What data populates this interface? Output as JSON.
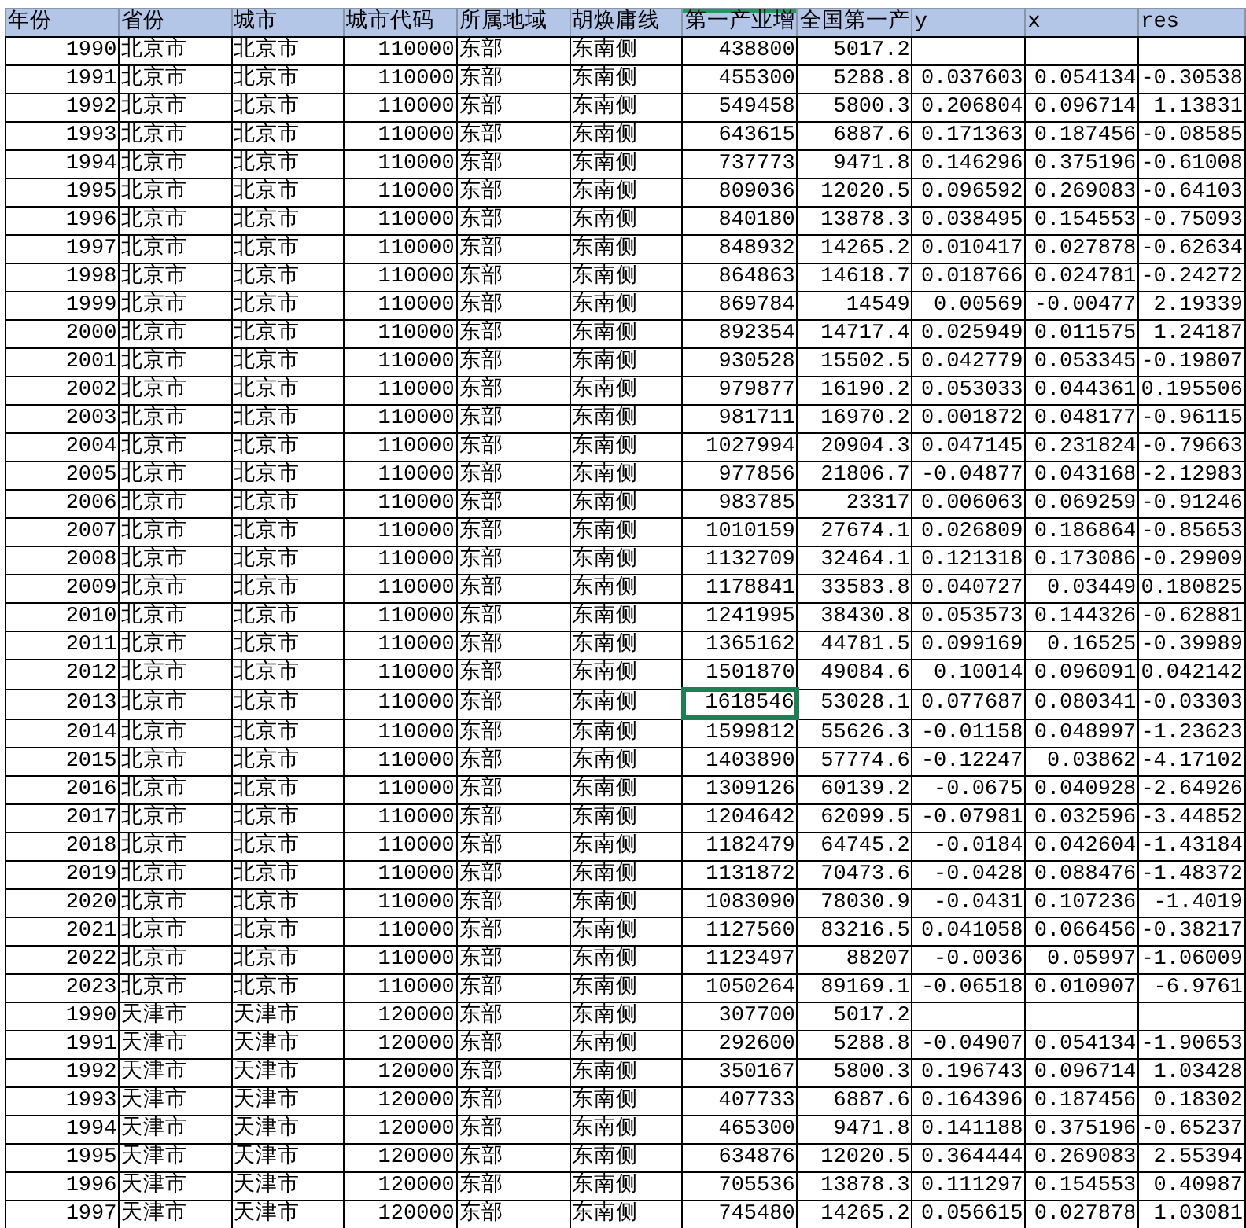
{
  "sheet": {
    "columns": [
      {
        "label": "年份",
        "kind": "number",
        "selected": false
      },
      {
        "label": "省份",
        "kind": "text",
        "selected": false
      },
      {
        "label": "城市",
        "kind": "text",
        "selected": false
      },
      {
        "label": "城市代码",
        "kind": "number",
        "selected": false
      },
      {
        "label": "所属地域",
        "kind": "text",
        "selected": false
      },
      {
        "label": "胡焕庸线",
        "kind": "text",
        "selected": false
      },
      {
        "label": "第一产业增",
        "kind": "number",
        "selected": true
      },
      {
        "label": "全国第一产",
        "kind": "number",
        "selected": false
      },
      {
        "label": "y",
        "kind": "number",
        "selected": false
      },
      {
        "label": "x",
        "kind": "number",
        "selected": false
      },
      {
        "label": "res",
        "kind": "number",
        "selected": false
      }
    ],
    "rows": [
      {
        "selected": false,
        "cells": [
          "1990",
          "北京市",
          "北京市",
          "110000",
          "东部",
          "东南侧",
          "438800",
          "5017.2",
          null,
          null,
          null
        ]
      },
      {
        "selected": false,
        "cells": [
          "1991",
          "北京市",
          "北京市",
          "110000",
          "东部",
          "东南侧",
          "455300",
          "5288.8",
          "0.037603",
          "0.054134",
          "-0.30538"
        ]
      },
      {
        "selected": false,
        "cells": [
          "1992",
          "北京市",
          "北京市",
          "110000",
          "东部",
          "东南侧",
          "549458",
          "5800.3",
          "0.206804",
          "0.096714",
          "1.13831"
        ]
      },
      {
        "selected": false,
        "cells": [
          "1993",
          "北京市",
          "北京市",
          "110000",
          "东部",
          "东南侧",
          "643615",
          "6887.6",
          "0.171363",
          "0.187456",
          "-0.08585"
        ]
      },
      {
        "selected": false,
        "cells": [
          "1994",
          "北京市",
          "北京市",
          "110000",
          "东部",
          "东南侧",
          "737773",
          "9471.8",
          "0.146296",
          "0.375196",
          "-0.61008"
        ]
      },
      {
        "selected": false,
        "cells": [
          "1995",
          "北京市",
          "北京市",
          "110000",
          "东部",
          "东南侧",
          "809036",
          "12020.5",
          "0.096592",
          "0.269083",
          "-0.64103"
        ]
      },
      {
        "selected": false,
        "cells": [
          "1996",
          "北京市",
          "北京市",
          "110000",
          "东部",
          "东南侧",
          "840180",
          "13878.3",
          "0.038495",
          "0.154553",
          "-0.75093"
        ]
      },
      {
        "selected": false,
        "cells": [
          "1997",
          "北京市",
          "北京市",
          "110000",
          "东部",
          "东南侧",
          "848932",
          "14265.2",
          "0.010417",
          "0.027878",
          "-0.62634"
        ]
      },
      {
        "selected": false,
        "cells": [
          "1998",
          "北京市",
          "北京市",
          "110000",
          "东部",
          "东南侧",
          "864863",
          "14618.7",
          "0.018766",
          "0.024781",
          "-0.24272"
        ]
      },
      {
        "selected": false,
        "cells": [
          "1999",
          "北京市",
          "北京市",
          "110000",
          "东部",
          "东南侧",
          "869784",
          "14549",
          "0.00569",
          "-0.00477",
          "2.19339"
        ]
      },
      {
        "selected": false,
        "cells": [
          "2000",
          "北京市",
          "北京市",
          "110000",
          "东部",
          "东南侧",
          "892354",
          "14717.4",
          "0.025949",
          "0.011575",
          "1.24187"
        ]
      },
      {
        "selected": false,
        "cells": [
          "2001",
          "北京市",
          "北京市",
          "110000",
          "东部",
          "东南侧",
          "930528",
          "15502.5",
          "0.042779",
          "0.053345",
          "-0.19807"
        ]
      },
      {
        "selected": false,
        "cells": [
          "2002",
          "北京市",
          "北京市",
          "110000",
          "东部",
          "东南侧",
          "979877",
          "16190.2",
          "0.053033",
          "0.044361",
          "0.195506"
        ]
      },
      {
        "selected": false,
        "cells": [
          "2003",
          "北京市",
          "北京市",
          "110000",
          "东部",
          "东南侧",
          "981711",
          "16970.2",
          "0.001872",
          "0.048177",
          "-0.96115"
        ]
      },
      {
        "selected": false,
        "cells": [
          "2004",
          "北京市",
          "北京市",
          "110000",
          "东部",
          "东南侧",
          "1027994",
          "20904.3",
          "0.047145",
          "0.231824",
          "-0.79663"
        ]
      },
      {
        "selected": false,
        "cells": [
          "2005",
          "北京市",
          "北京市",
          "110000",
          "东部",
          "东南侧",
          "977856",
          "21806.7",
          "-0.04877",
          "0.043168",
          "-2.12983"
        ]
      },
      {
        "selected": false,
        "cells": [
          "2006",
          "北京市",
          "北京市",
          "110000",
          "东部",
          "东南侧",
          "983785",
          "23317",
          "0.006063",
          "0.069259",
          "-0.91246"
        ]
      },
      {
        "selected": false,
        "cells": [
          "2007",
          "北京市",
          "北京市",
          "110000",
          "东部",
          "东南侧",
          "1010159",
          "27674.1",
          "0.026809",
          "0.186864",
          "-0.85653"
        ]
      },
      {
        "selected": false,
        "cells": [
          "2008",
          "北京市",
          "北京市",
          "110000",
          "东部",
          "东南侧",
          "1132709",
          "32464.1",
          "0.121318",
          "0.173086",
          "-0.29909"
        ]
      },
      {
        "selected": false,
        "cells": [
          "2009",
          "北京市",
          "北京市",
          "110000",
          "东部",
          "东南侧",
          "1178841",
          "33583.8",
          "0.040727",
          "0.03449",
          "0.180825"
        ]
      },
      {
        "selected": false,
        "cells": [
          "2010",
          "北京市",
          "北京市",
          "110000",
          "东部",
          "东南侧",
          "1241995",
          "38430.8",
          "0.053573",
          "0.144326",
          "-0.62881"
        ]
      },
      {
        "selected": false,
        "cells": [
          "2011",
          "北京市",
          "北京市",
          "110000",
          "东部",
          "东南侧",
          "1365162",
          "44781.5",
          "0.099169",
          "0.16525",
          "-0.39989"
        ]
      },
      {
        "selected": false,
        "cells": [
          "2012",
          "北京市",
          "北京市",
          "110000",
          "东部",
          "东南侧",
          "1501870",
          "49084.6",
          "0.10014",
          "0.096091",
          "0.042142"
        ]
      },
      {
        "selected": true,
        "cells": [
          "2013",
          "北京市",
          "北京市",
          "110000",
          "东部",
          "东南侧",
          "1618546",
          "53028.1",
          "0.077687",
          "0.080341",
          "-0.03303"
        ]
      },
      {
        "selected": false,
        "cells": [
          "2014",
          "北京市",
          "北京市",
          "110000",
          "东部",
          "东南侧",
          "1599812",
          "55626.3",
          "-0.01158",
          "0.048997",
          "-1.23623"
        ]
      },
      {
        "selected": false,
        "cells": [
          "2015",
          "北京市",
          "北京市",
          "110000",
          "东部",
          "东南侧",
          "1403890",
          "57774.6",
          "-0.12247",
          "0.03862",
          "-4.17102"
        ]
      },
      {
        "selected": false,
        "cells": [
          "2016",
          "北京市",
          "北京市",
          "110000",
          "东部",
          "东南侧",
          "1309126",
          "60139.2",
          "-0.0675",
          "0.040928",
          "-2.64926"
        ]
      },
      {
        "selected": false,
        "cells": [
          "2017",
          "北京市",
          "北京市",
          "110000",
          "东部",
          "东南侧",
          "1204642",
          "62099.5",
          "-0.07981",
          "0.032596",
          "-3.44852"
        ]
      },
      {
        "selected": false,
        "cells": [
          "2018",
          "北京市",
          "北京市",
          "110000",
          "东部",
          "东南侧",
          "1182479",
          "64745.2",
          "-0.0184",
          "0.042604",
          "-1.43184"
        ]
      },
      {
        "selected": false,
        "cells": [
          "2019",
          "北京市",
          "北京市",
          "110000",
          "东部",
          "东南侧",
          "1131872",
          "70473.6",
          "-0.0428",
          "0.088476",
          "-1.48372"
        ]
      },
      {
        "selected": false,
        "cells": [
          "2020",
          "北京市",
          "北京市",
          "110000",
          "东部",
          "东南侧",
          "1083090",
          "78030.9",
          "-0.0431",
          "0.107236",
          "-1.4019"
        ]
      },
      {
        "selected": false,
        "cells": [
          "2021",
          "北京市",
          "北京市",
          "110000",
          "东部",
          "东南侧",
          "1127560",
          "83216.5",
          "0.041058",
          "0.066456",
          "-0.38217"
        ]
      },
      {
        "selected": false,
        "cells": [
          "2022",
          "北京市",
          "北京市",
          "110000",
          "东部",
          "东南侧",
          "1123497",
          "88207",
          "-0.0036",
          "0.05997",
          "-1.06009"
        ]
      },
      {
        "selected": false,
        "cells": [
          "2023",
          "北京市",
          "北京市",
          "110000",
          "东部",
          "东南侧",
          "1050264",
          "89169.1",
          "-0.06518",
          "0.010907",
          "-6.9761"
        ]
      },
      {
        "selected": false,
        "cells": [
          "1990",
          "天津市",
          "天津市",
          "120000",
          "东部",
          "东南侧",
          "307700",
          "5017.2",
          null,
          null,
          null
        ]
      },
      {
        "selected": false,
        "cells": [
          "1991",
          "天津市",
          "天津市",
          "120000",
          "东部",
          "东南侧",
          "292600",
          "5288.8",
          "-0.04907",
          "0.054134",
          "-1.90653"
        ]
      },
      {
        "selected": false,
        "cells": [
          "1992",
          "天津市",
          "天津市",
          "120000",
          "东部",
          "东南侧",
          "350167",
          "5800.3",
          "0.196743",
          "0.096714",
          "1.03428"
        ]
      },
      {
        "selected": false,
        "cells": [
          "1993",
          "天津市",
          "天津市",
          "120000",
          "东部",
          "东南侧",
          "407733",
          "6887.6",
          "0.164396",
          "0.187456",
          "0.18302"
        ]
      },
      {
        "selected": false,
        "cells": [
          "1994",
          "天津市",
          "天津市",
          "120000",
          "东部",
          "东南侧",
          "465300",
          "9471.8",
          "0.141188",
          "0.375196",
          "-0.65237"
        ]
      },
      {
        "selected": false,
        "cells": [
          "1995",
          "天津市",
          "天津市",
          "120000",
          "东部",
          "东南侧",
          "634876",
          "12020.5",
          "0.364444",
          "0.269083",
          "2.55394"
        ]
      },
      {
        "selected": false,
        "cells": [
          "1996",
          "天津市",
          "天津市",
          "120000",
          "东部",
          "东南侧",
          "705536",
          "13878.3",
          "0.111297",
          "0.154553",
          "0.40987"
        ]
      },
      {
        "selected": false,
        "cells": [
          "1997",
          "天津市",
          "天津市",
          "120000",
          "东部",
          "东南侧",
          "745480",
          "14265.2",
          "0.056615",
          "0.027878",
          "1.03081"
        ]
      }
    ]
  }
}
